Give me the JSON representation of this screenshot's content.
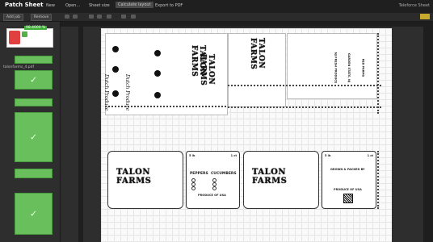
{
  "app": {
    "title": "Patch Sheet",
    "brand": "Teleforce Sheet"
  },
  "menu": {
    "items": [
      "New",
      "Open...",
      "Sheet size",
      "Calculate layout",
      "Export to PDF"
    ],
    "active": "Calculate layout"
  },
  "toolbar": {
    "add_job": "Add job",
    "remove": "Remove"
  },
  "left_panel": {
    "selected_percent": "98.4000 %",
    "file_name": "talonfarms_4.pdf"
  },
  "canvas": {
    "brand_logo": "TALON FARMS",
    "script_text": "Dutch Produce",
    "pepper_card": {
      "size": "5 lb",
      "count": "1 ct",
      "col1": "PEPPERS",
      "col2": "CUCUMBERS",
      "produce_of": "PRODUCE OF USA"
    },
    "right_card": {
      "size": "5 lb",
      "count": "1 ct",
      "grown": "GROWN & PACKED BY",
      "produce_of": "PRODUCE OF USA"
    },
    "side_stamp": "GARDEN STATE, NJ",
    "vertical_text_1": "RED FARMS",
    "vertical_text_2": "NJ FRESH PRODUCE"
  },
  "colors": {
    "accent_green": "#68bf5c",
    "highlight_yellow": "#c7a92c"
  }
}
